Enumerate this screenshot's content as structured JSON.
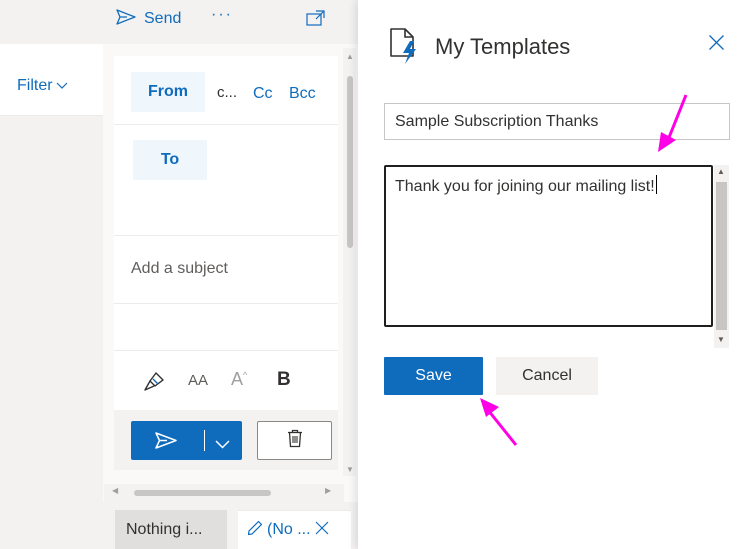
{
  "mail_list": {
    "filter_label": "Filter"
  },
  "compose_toolbar": {
    "send_label": "Send",
    "more_label": "···",
    "popout_icon": "popout-icon"
  },
  "compose": {
    "from_label": "From",
    "from_address": "c...",
    "cc_label": "Cc",
    "bcc_label": "Bcc",
    "to_label": "To",
    "subject_placeholder": "Add a subject",
    "format_icons": [
      "brush-icon",
      "font-size-icon",
      "grow-font-icon",
      "bold-icon"
    ],
    "font_size_label": "AA",
    "grow_font_label": "A",
    "bold_label": "B"
  },
  "tabs": [
    {
      "label": "Nothing i..."
    },
    {
      "label": "(No ..."
    }
  ],
  "templates_pane": {
    "title": "My Templates",
    "template_name": "Sample Subscription Thanks",
    "template_body": "Thank you for joining our mailing list!",
    "save_label": "Save",
    "cancel_label": "Cancel"
  },
  "colors": {
    "accent": "#0f6cbd",
    "annotation": "#ff00e6"
  }
}
